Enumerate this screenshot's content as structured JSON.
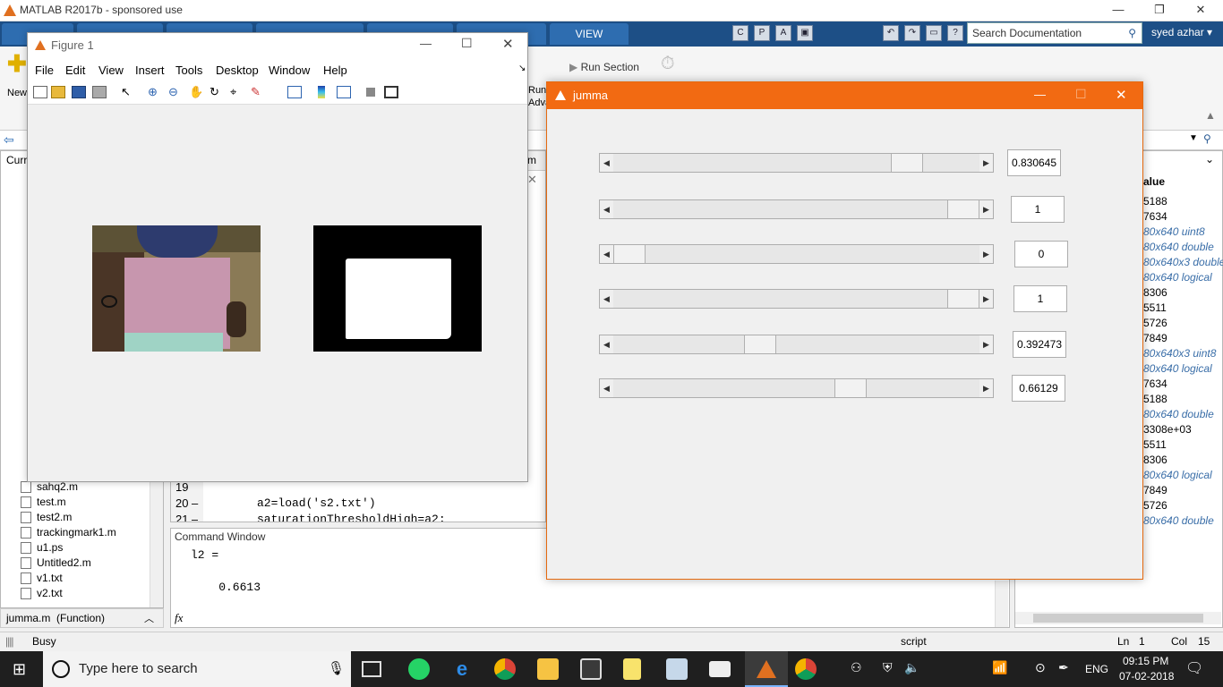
{
  "app": {
    "title": "MATLAB R2017b - sponsored use",
    "ribbon_tabs": [
      "VIEW"
    ],
    "search_placeholder": "Search Documentation",
    "user": "syed azhar",
    "ribbon": {
      "new_label": "New",
      "run_section": "Run Section",
      "run_adv_lines": [
        "Run a",
        "Adva"
      ]
    },
    "current_folder_label": "Curr",
    "file_list": [
      "sahq2.m",
      "test.m",
      "test2.m",
      "trackingmark1.m",
      "u1.ps",
      "Untitled2.m",
      "v1.txt",
      "v2.txt"
    ],
    "details_label": "jumma.m  (Function)",
    "editor": {
      "tab_fragment": "m",
      "line_numbers": [
        "19",
        "20",
        "21"
      ],
      "lines": [
        "",
        "a2=load('s2.txt')",
        "saturationThresholdHigh=a2;"
      ]
    },
    "command_window": {
      "title": "Command Window",
      "output_lines": [
        "l2 =",
        "",
        "    0.6613"
      ],
      "prompt": "fx"
    },
    "workspace": {
      "header": "alue",
      "values": [
        {
          "text": "5188",
          "italic": false
        },
        {
          "text": "7634",
          "italic": false
        },
        {
          "text": "80x640 uint8",
          "italic": true
        },
        {
          "text": "80x640 double",
          "italic": true
        },
        {
          "text": "80x640x3 double",
          "italic": true
        },
        {
          "text": "80x640 logical",
          "italic": true
        },
        {
          "text": "8306",
          "italic": false
        },
        {
          "text": "5511",
          "italic": false
        },
        {
          "text": "5726",
          "italic": false
        },
        {
          "text": "7849",
          "italic": false
        },
        {
          "text": "80x640x3 uint8",
          "italic": true
        },
        {
          "text": "80x640 logical",
          "italic": true
        },
        {
          "text": "7634",
          "italic": false
        },
        {
          "text": "5188",
          "italic": false
        },
        {
          "text": "80x640 double",
          "italic": true
        },
        {
          "text": "3308e+03",
          "italic": false
        },
        {
          "text": "5511",
          "italic": false
        },
        {
          "text": "8306",
          "italic": false
        },
        {
          "text": "80x640 logical",
          "italic": true
        },
        {
          "text": "7849",
          "italic": false
        },
        {
          "text": "5726",
          "italic": false
        },
        {
          "text": "80x640 double",
          "italic": true
        }
      ]
    },
    "status": {
      "left": "Busy",
      "mode": "script",
      "ln_label": "Ln",
      "ln": "1",
      "col_label": "Col",
      "col": "15"
    }
  },
  "figure1": {
    "title": "Figure 1",
    "menu": [
      "File",
      "Edit",
      "View",
      "Insert",
      "Tools",
      "Desktop",
      "Window",
      "Help"
    ]
  },
  "jumma": {
    "title": "jumma",
    "sliders": [
      {
        "value": 0.830645,
        "label": "0.830645"
      },
      {
        "value": 1,
        "label": "1"
      },
      {
        "value": 0,
        "label": "0"
      },
      {
        "value": 1,
        "label": "1"
      },
      {
        "value": 0.392473,
        "label": "0.392473"
      },
      {
        "value": 0.66129,
        "label": "0.66129"
      }
    ]
  },
  "taskbar": {
    "search_placeholder": "Type here to search",
    "language": "ENG",
    "time": "09:15 PM",
    "date": "07-02-2018"
  },
  "colors": {
    "ribbon_bg": "#1d4f86",
    "jumma_title": "#f26a12",
    "taskbar": "#1f1f1f"
  }
}
